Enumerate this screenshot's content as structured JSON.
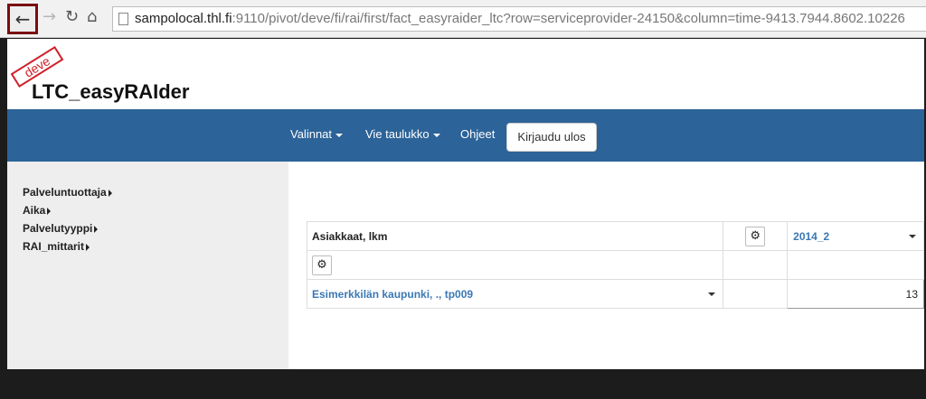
{
  "browser": {
    "back_icon": "←",
    "forward_icon": "→",
    "reload_icon": "↻",
    "home_icon": "⌂",
    "url_host": "sampolocal.thl.fi",
    "url_rest": ":9110/pivot/deve/fi/rai/first/fact_easyraider_ltc?row=serviceprovider-24150&column=time-9413.7944.8602.10226"
  },
  "header": {
    "stamp": "deve",
    "title": "LTC_easyRAIder"
  },
  "navbar": {
    "valinnat": "Valinnat",
    "vie_taulukko": "Vie taulukko",
    "ohjeet": "Ohjeet",
    "logout": "Kirjaudu ulos"
  },
  "sidebar": {
    "items": [
      {
        "label": "Palveluntuottaja"
      },
      {
        "label": "Aika"
      },
      {
        "label": "Palvelutyyppi"
      },
      {
        "label": "RAI_mittarit"
      }
    ]
  },
  "pivot": {
    "measure_label": "Asiakkaat, lkm",
    "gear_icon": "⚙",
    "column_header": "2014_2",
    "row_header": "Esimerkkilän kaupunki, ., tp009",
    "value": "13"
  }
}
